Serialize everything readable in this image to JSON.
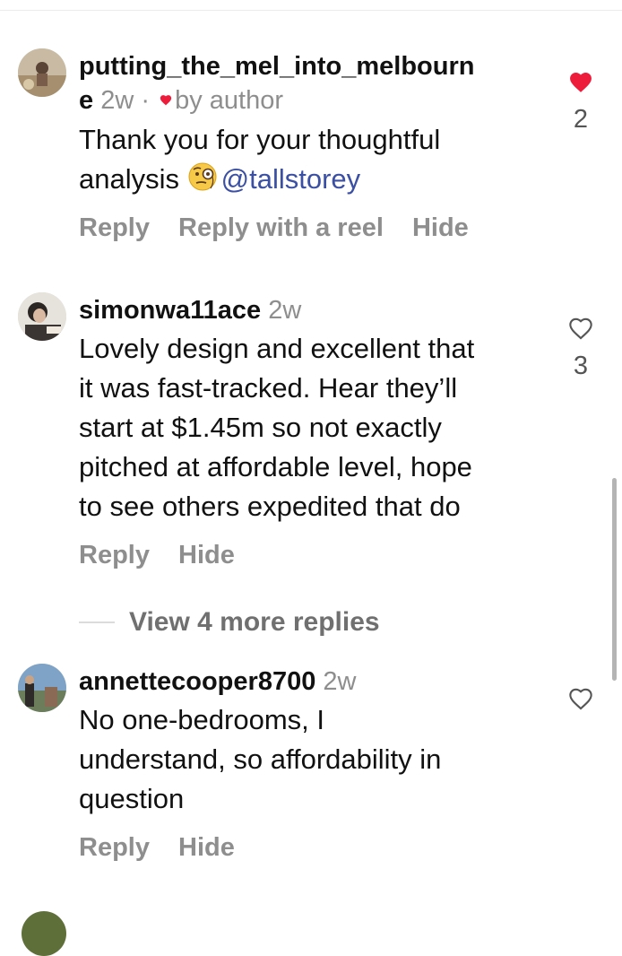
{
  "colors": {
    "like_red": "#ee1c3b",
    "secondary_text": "#8e8e8e",
    "mention": "#3b4fa3"
  },
  "comments": [
    {
      "username": "putting_the_mel_into_melbourne",
      "username_line1": "putting_the_mel_into_melbourn",
      "username_line2": "e",
      "time": "2w",
      "separator": "·",
      "by_author": "by author",
      "text_lines": [
        "Thank you for your thoughtful",
        "analysis"
      ],
      "emoji": "face-with-monocle",
      "mention": "@tallstorey",
      "actions": [
        "Reply",
        "Reply with a reel",
        "Hide"
      ],
      "liked": true,
      "like_count": "2"
    },
    {
      "username": "simonwa11ace",
      "time": "2w",
      "text_lines": [
        "Lovely design and excellent that",
        "it was fast-tracked.  Hear they’ll",
        "start at $1.45m so not exactly",
        "pitched at affordable level, hope",
        "to see others expedited that do"
      ],
      "actions": [
        "Reply",
        "Hide"
      ],
      "liked": false,
      "like_count": "3",
      "view_replies": "View 4 more replies"
    },
    {
      "username": "annettecooper8700",
      "time": "2w",
      "text_lines": [
        "No one-bedrooms, I",
        "understand, so affordability in",
        "question"
      ],
      "actions": [
        "Reply",
        "Hide"
      ],
      "liked": false
    }
  ]
}
